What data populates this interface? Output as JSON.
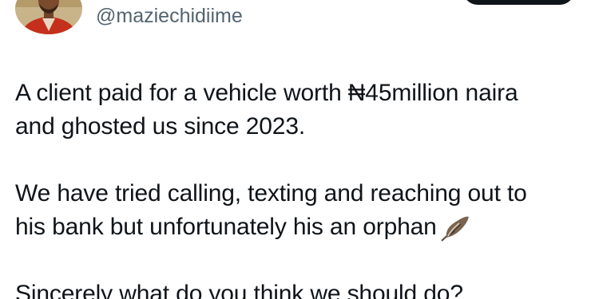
{
  "author": {
    "handle": "@maziechidiime",
    "avatar_icon": "profile-photo"
  },
  "follow_button": {
    "label": ""
  },
  "tweet": {
    "lines": [
      "A client paid for a vehicle worth ₦45million naira",
      "and ghosted us since 2023.",
      "We have tried calling, texting and reaching out to",
      "his bank but unfortunately his an orphan",
      "Sincerely what do you think we should do?"
    ],
    "emoji_icon": "feather-icon"
  },
  "colors": {
    "text": "#0f1419",
    "secondary": "#536471",
    "button": "#0f1419"
  }
}
